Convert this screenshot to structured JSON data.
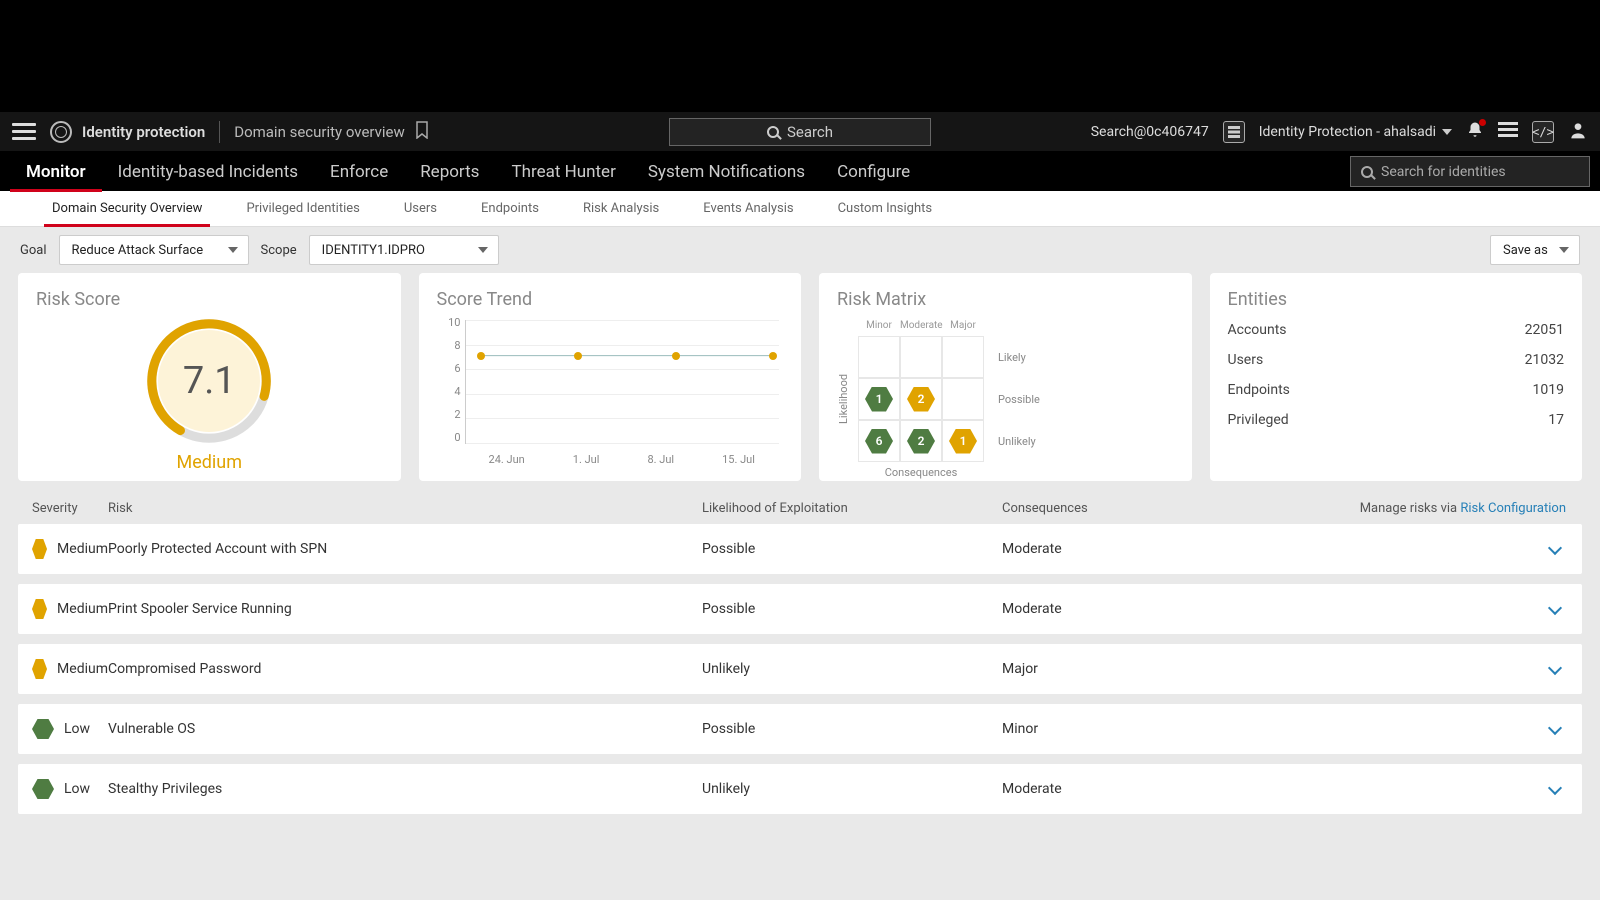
{
  "top": {
    "brand": "Identity protection",
    "breadcrumb": "Domain security overview",
    "search_placeholder": "Search",
    "account_label": "Search@0c406747",
    "tenant_label": "Identity Protection - ahalsadi"
  },
  "nav": {
    "items": [
      "Monitor",
      "Identity-based Incidents",
      "Enforce",
      "Reports",
      "Threat Hunter",
      "System Notifications",
      "Configure"
    ],
    "active": 0,
    "identity_search_placeholder": "Search for identities"
  },
  "subtabs": {
    "items": [
      "Domain Security Overview",
      "Privileged Identities",
      "Users",
      "Endpoints",
      "Risk Analysis",
      "Events Analysis",
      "Custom Insights"
    ],
    "active": 0
  },
  "filters": {
    "goal_label": "Goal",
    "goal_value": "Reduce Attack Surface",
    "scope_label": "Scope",
    "scope_value": "IDENTITY1.IDPRO",
    "save_as": "Save as"
  },
  "risk_score": {
    "title": "Risk Score",
    "value": "7.1",
    "rating": "Medium"
  },
  "trend": {
    "title": "Score Trend"
  },
  "matrix": {
    "title": "Risk Matrix",
    "cols": [
      "Minor",
      "Moderate",
      "Major"
    ],
    "rows": [
      "Likely",
      "Possible",
      "Unlikely"
    ],
    "xaxis": "Consequences",
    "yaxis": "Likelihood",
    "cells": {
      "Possible_Minor": {
        "val": "1",
        "cls": "green"
      },
      "Possible_Moderate": {
        "val": "2",
        "cls": "amber"
      },
      "Unlikely_Minor": {
        "val": "6",
        "cls": "green"
      },
      "Unlikely_Moderate": {
        "val": "2",
        "cls": "green"
      },
      "Unlikely_Major": {
        "val": "1",
        "cls": "amber"
      }
    }
  },
  "entities": {
    "title": "Entities",
    "rows": [
      {
        "label": "Accounts",
        "value": "22051"
      },
      {
        "label": "Users",
        "value": "21032"
      },
      {
        "label": "Endpoints",
        "value": "1019"
      },
      {
        "label": "Privileged",
        "value": "17"
      }
    ]
  },
  "table": {
    "headers": {
      "severity": "Severity",
      "risk": "Risk",
      "likelihood": "Likelihood of Exploitation",
      "consequences": "Consequences"
    },
    "manage_prefix": "Manage risks via ",
    "manage_link": "Risk Configuration",
    "rows": [
      {
        "sev": "Medium",
        "sevcls": "med",
        "risk": "Poorly Protected Account with SPN",
        "like": "Possible",
        "cons": "Moderate"
      },
      {
        "sev": "Medium",
        "sevcls": "med",
        "risk": "Print Spooler Service Running",
        "like": "Possible",
        "cons": "Moderate"
      },
      {
        "sev": "Medium",
        "sevcls": "med",
        "risk": "Compromised Password",
        "like": "Unlikely",
        "cons": "Major"
      },
      {
        "sev": "Low",
        "sevcls": "low",
        "risk": "Vulnerable OS",
        "like": "Possible",
        "cons": "Minor"
      },
      {
        "sev": "Low",
        "sevcls": "low",
        "risk": "Stealthy Privileges",
        "like": "Unlikely",
        "cons": "Moderate"
      }
    ]
  },
  "chart_data": {
    "type": "line",
    "title": "Score Trend",
    "xlabel": "",
    "ylabel": "",
    "ylim": [
      0,
      10
    ],
    "yticks": [
      0,
      2,
      4,
      6,
      8,
      10
    ],
    "categories": [
      "24. Jun",
      "1. Jul",
      "8. Jul",
      "15. Jul"
    ],
    "series": [
      {
        "name": "Risk Score",
        "values": [
          7.1,
          7.1,
          7.1,
          7.1
        ]
      }
    ]
  }
}
